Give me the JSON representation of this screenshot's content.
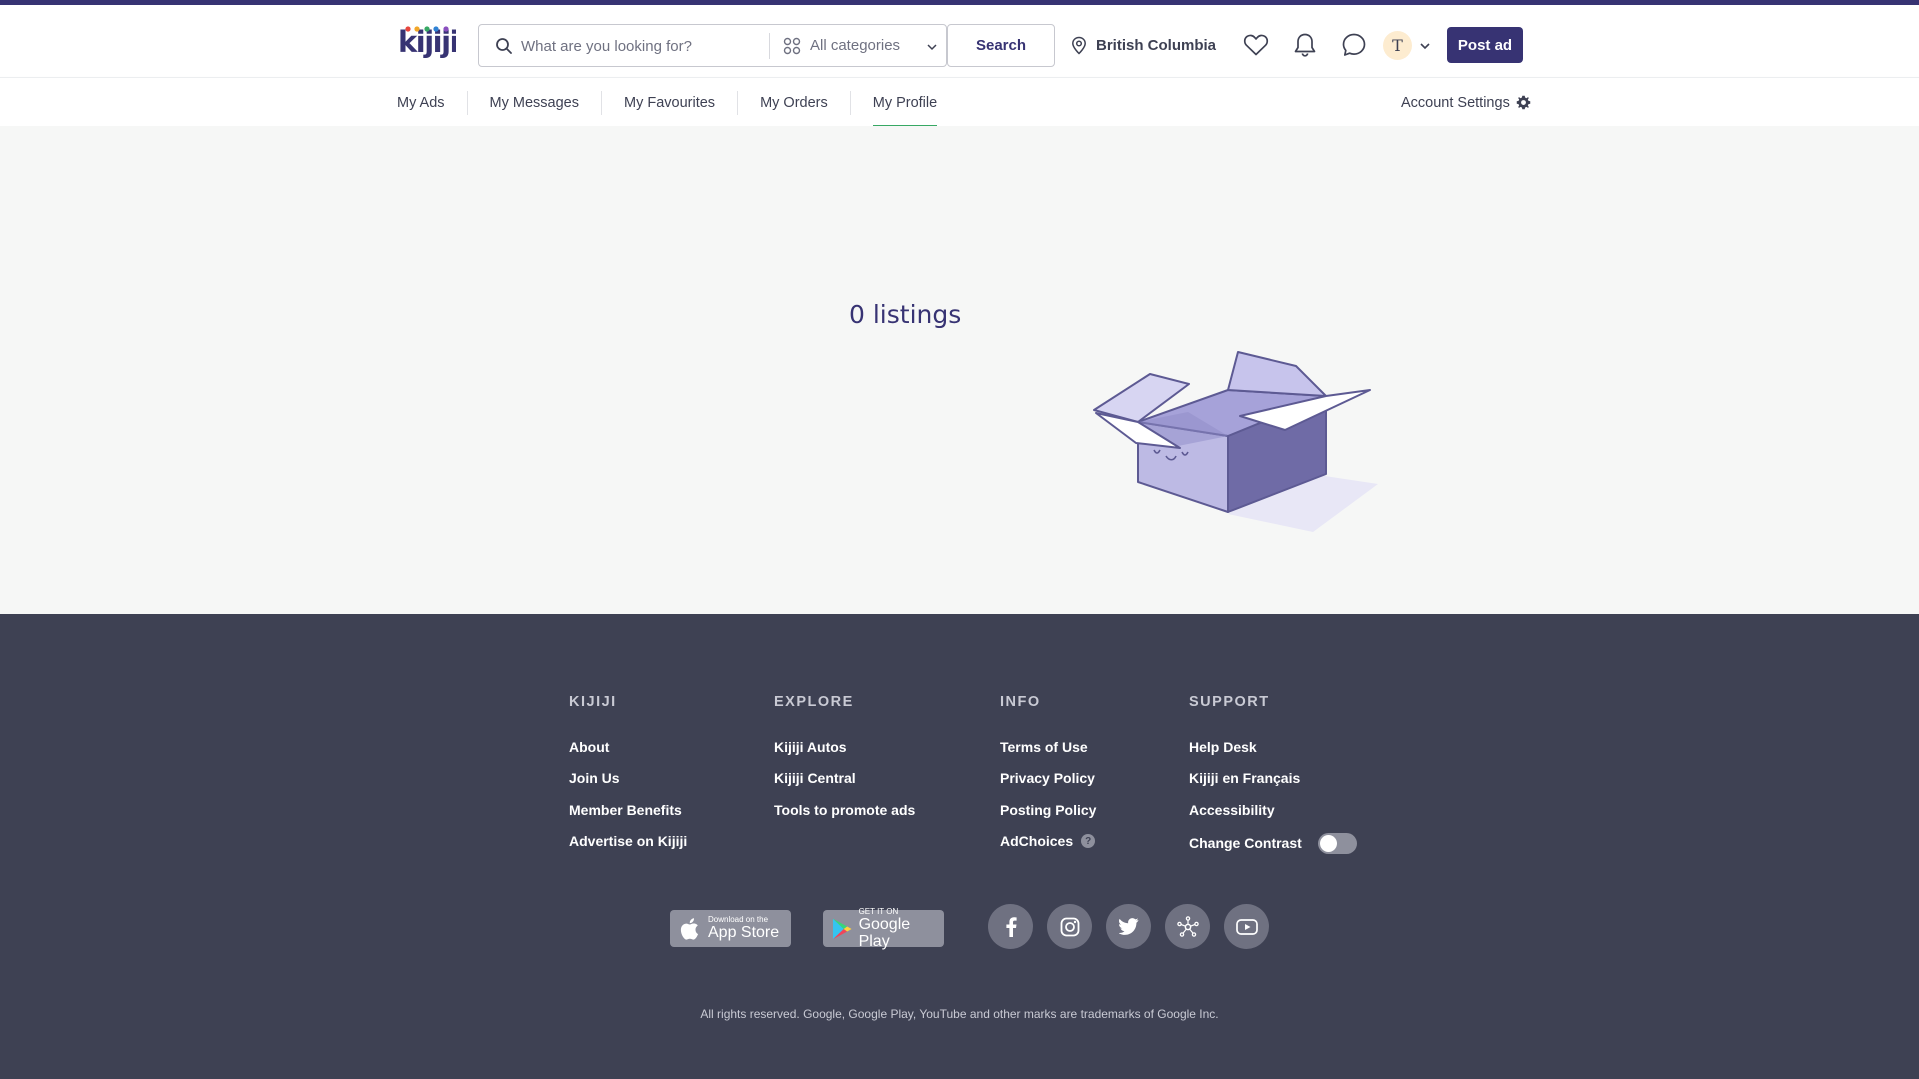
{
  "header": {
    "logo_text": "kijiji",
    "search_placeholder": "What are you looking for?",
    "search_value": "",
    "category_label": "All categories",
    "search_button": "Search",
    "location": "British Columbia",
    "avatar_initial": "T",
    "post_ad": "Post ad"
  },
  "subnav": {
    "tabs": [
      {
        "label": "My Ads",
        "active": false
      },
      {
        "label": "My Messages",
        "active": false
      },
      {
        "label": "My Favourites",
        "active": false
      },
      {
        "label": "My Orders",
        "active": false
      },
      {
        "label": "My Profile",
        "active": true
      }
    ],
    "account_settings": "Account Settings"
  },
  "main": {
    "listings_text": "0 listings"
  },
  "footer": {
    "columns": [
      {
        "heading": "KIJIJI",
        "links": [
          "About",
          "Join Us",
          "Member Benefits",
          "Advertise on Kijiji"
        ]
      },
      {
        "heading": "EXPLORE",
        "links": [
          "Kijiji Autos",
          "Kijiji Central",
          "Tools to promote ads"
        ]
      },
      {
        "heading": "INFO",
        "links": [
          "Terms of Use",
          "Privacy Policy",
          "Posting Policy",
          "AdChoices"
        ]
      },
      {
        "heading": "SUPPORT",
        "links": [
          "Help Desk",
          "Kijiji en Français",
          "Accessibility",
          "Change Contrast"
        ]
      }
    ],
    "app_store": {
      "small": "Download on the",
      "big": "App Store"
    },
    "google_play": {
      "small": "GET IT ON",
      "big": "Google Play"
    },
    "social_icons": [
      "facebook-icon",
      "instagram-icon",
      "twitter-icon",
      "network-icon",
      "youtube-icon"
    ],
    "change_contrast_on": false,
    "copyright": "All rights reserved. Google, Google Play, YouTube and other marks are trademarks of Google Inc."
  },
  "colors": {
    "brand": "#373373",
    "footer_bg": "#3e4153",
    "active_tab": "#37a864",
    "page_bg": "#f6f7f6"
  }
}
